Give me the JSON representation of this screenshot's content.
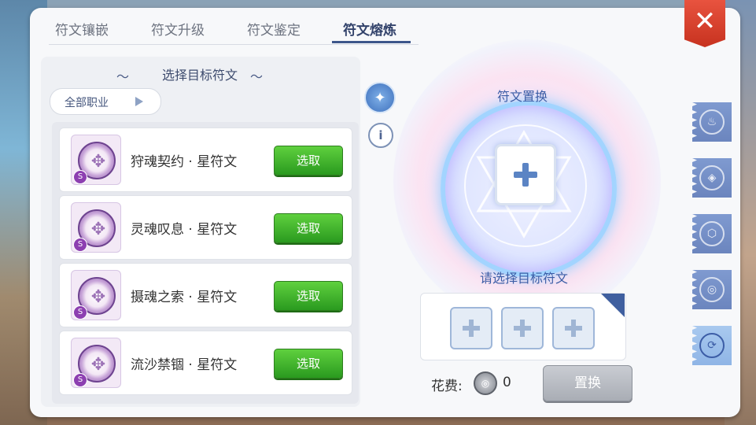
{
  "tabs": [
    {
      "label": "符文镶嵌",
      "active": false
    },
    {
      "label": "符文升级",
      "active": false
    },
    {
      "label": "符文鉴定",
      "active": false
    },
    {
      "label": "符文熔炼",
      "active": true
    }
  ],
  "close": {
    "label": "✕"
  },
  "left": {
    "title": "选择目标符文",
    "filter": {
      "label": "全部职业"
    },
    "items": [
      {
        "name": "狩魂契约 · 星符文",
        "button": "选取",
        "badge": "S"
      },
      {
        "name": "灵魂叹息 · 星符文",
        "button": "选取",
        "badge": "S"
      },
      {
        "name": "摄魂之索 · 星符文",
        "button": "选取",
        "badge": "S"
      },
      {
        "name": "流沙禁锢 · 星符文",
        "button": "选取",
        "badge": "S"
      }
    ]
  },
  "tools": {
    "wand_icon": "magic-wand-icon",
    "info_icon": "info-icon",
    "info_glyph": "i"
  },
  "magic": {
    "title": "符文置换",
    "select_label": "请选择目标符文"
  },
  "cost": {
    "label": "花费:",
    "value": "0"
  },
  "replace_button": "置换",
  "side_tabs": [
    {
      "icon": "flame-crest-icon",
      "active": false
    },
    {
      "icon": "drop-crest-icon",
      "active": false
    },
    {
      "icon": "shield-crest-icon",
      "active": false
    },
    {
      "icon": "swirl-crest-icon",
      "active": false
    },
    {
      "icon": "rune-exchange-icon",
      "active": true
    }
  ],
  "colors": {
    "accent": "#3c5da6",
    "button_green": "#3fb52b",
    "close_red": "#d9432f"
  }
}
